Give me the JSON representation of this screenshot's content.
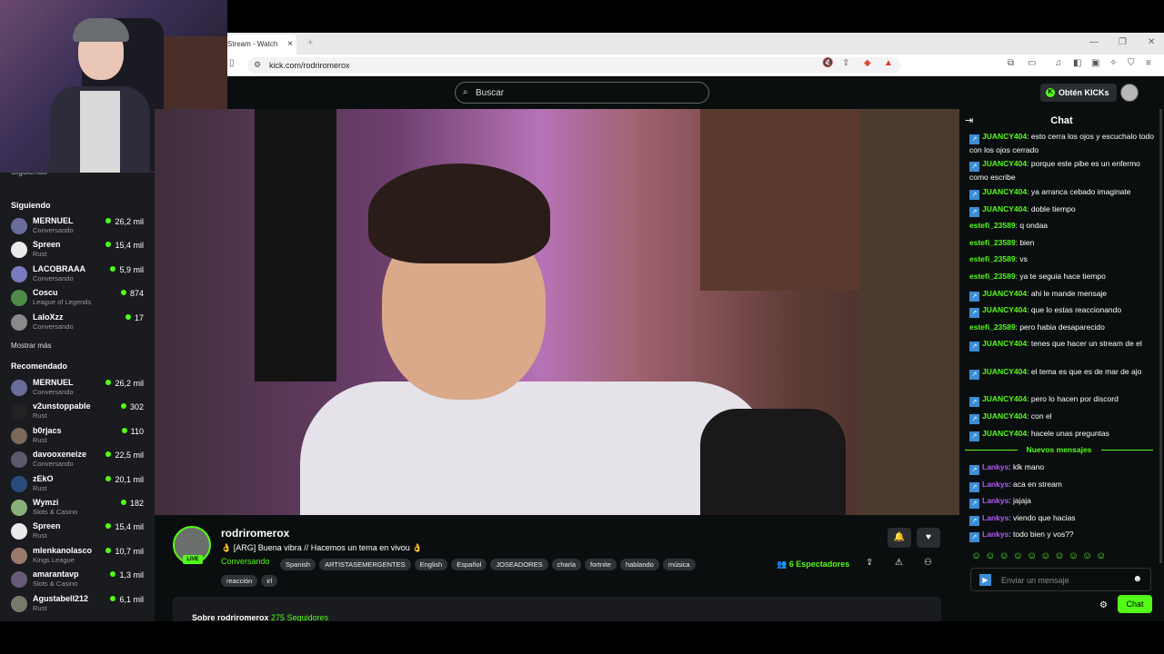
{
  "browser": {
    "tab_title": "Stream - Watch",
    "tab_close": "×",
    "new_tab": "+",
    "url": "kick.com/rodriromerox",
    "window_controls": [
      "—",
      "❐",
      "✕"
    ]
  },
  "header": {
    "search_placeholder": "Buscar",
    "kicks_button": "Obtén KICKs"
  },
  "sidebar": {
    "partial_label": "Siguiendo",
    "following_title": "Siguiendo",
    "following": [
      {
        "name": "MERNUEL",
        "category": "Conversando",
        "viewers": "26,2 mil"
      },
      {
        "name": "Spreen",
        "category": "Rust",
        "viewers": "15,4 mil"
      },
      {
        "name": "LACOBRAAA",
        "category": "Conversando",
        "viewers": "5,9 mil"
      },
      {
        "name": "Coscu",
        "category": "League of Legends",
        "viewers": "874"
      },
      {
        "name": "LaloXzz",
        "category": "Conversando",
        "viewers": "17"
      }
    ],
    "show_more": "Mostrar más",
    "recommended_title": "Recomendado",
    "recommended": [
      {
        "name": "MERNUEL",
        "category": "Conversando",
        "viewers": "26,2 mil"
      },
      {
        "name": "v2unstoppable",
        "category": "Rust",
        "viewers": "302"
      },
      {
        "name": "b0rjacs",
        "category": "Rust",
        "viewers": "110"
      },
      {
        "name": "davooxeneize",
        "category": "Conversando",
        "viewers": "22,5 mil"
      },
      {
        "name": "zEkO",
        "category": "Rust",
        "viewers": "20,1 mil"
      },
      {
        "name": "Wymzi",
        "category": "Slots & Casino",
        "viewers": "182"
      },
      {
        "name": "Spreen",
        "category": "Rust",
        "viewers": "15,4 mil"
      },
      {
        "name": "mlenkanolasco",
        "category": "Kings League",
        "viewers": "10,7 mil"
      },
      {
        "name": "amarantavp",
        "category": "Slots & Casino",
        "viewers": "1,3 mil"
      },
      {
        "name": "Agustabell212",
        "category": "Rust",
        "viewers": "6,1 mil"
      }
    ]
  },
  "stream": {
    "channel": "rodriromerox",
    "live_badge": "LIVE",
    "title": "👌 [ARG] Buena vibra // Hacemos un tema en vivou 👌",
    "category": "Conversando",
    "tags": [
      "Spanish",
      "ARTISTASEMERGENTES",
      "English",
      "Español",
      "JOSEADORES",
      "charla",
      "fortnite",
      "hablando",
      "música"
    ],
    "tags_row2": [
      "reacción",
      "irl"
    ],
    "viewers_count": "6",
    "viewers_label": "Espectadores",
    "about_prefix": "Sobre rodriromerox",
    "about_followers": "275 Seguidores"
  },
  "chat": {
    "title": "Chat",
    "messages": [
      {
        "user": "JUANCY404",
        "color": "#53fc18",
        "badge": true,
        "text": "esto cerra los ojos y escuchalo todo con los ojos cerrado"
      },
      {
        "user": "JUANCY404",
        "color": "#53fc18",
        "badge": true,
        "text": "porque este pibe es un enfermo como escribe"
      },
      {
        "user": "JUANCY404",
        "color": "#53fc18",
        "badge": true,
        "text": "ya arranca cebado imaginate"
      },
      {
        "user": "JUANCY404",
        "color": "#53fc18",
        "badge": true,
        "text": "doble tiempo"
      },
      {
        "user": "estefi_23589",
        "color": "#53fc18",
        "badge": false,
        "text": "q ondaa"
      },
      {
        "user": "estefi_23589",
        "color": "#53fc18",
        "badge": false,
        "text": "bien"
      },
      {
        "user": "estefi_23589",
        "color": "#53fc18",
        "badge": false,
        "text": "vs"
      },
      {
        "user": "estefi_23589",
        "color": "#53fc18",
        "badge": false,
        "text": "ya te seguia hace tiempo"
      },
      {
        "user": "JUANCY404",
        "color": "#53fc18",
        "badge": true,
        "text": "ahi le mande mensaje"
      },
      {
        "user": "JUANCY404",
        "color": "#53fc18",
        "badge": true,
        "text": "que lo estas reaccionando"
      },
      {
        "user": "estefi_23589",
        "color": "#53fc18",
        "badge": false,
        "text": "pero habia desaparecido"
      },
      {
        "user": "JUANCY404",
        "color": "#53fc18",
        "badge": true,
        "text": "tenes que hacer un stream de el"
      },
      {
        "user": "JUANCY404",
        "color": "#53fc18",
        "badge": true,
        "text": "el tema es que es de mar de ajo"
      },
      {
        "user": "JUANCY404",
        "color": "#53fc18",
        "badge": true,
        "text": "pero lo hacen por discord"
      },
      {
        "user": "JUANCY404",
        "color": "#53fc18",
        "badge": true,
        "text": "con el"
      },
      {
        "user": "JUANCY404",
        "color": "#53fc18",
        "badge": true,
        "text": "hacele unas preguntas"
      }
    ],
    "new_messages_label": "Nuevos mensajes",
    "new_messages": [
      {
        "user": "Lankys",
        "color": "#b05cf5",
        "badge": true,
        "text": "klk mano"
      },
      {
        "user": "Lankys",
        "color": "#b05cf5",
        "badge": true,
        "text": "aca en stream"
      },
      {
        "user": "Lankys",
        "color": "#b05cf5",
        "badge": true,
        "text": "jajaja"
      },
      {
        "user": "Lankys",
        "color": "#b05cf5",
        "badge": true,
        "text": "viendo que hacias"
      },
      {
        "user": "Lankys",
        "color": "#b05cf5",
        "badge": true,
        "text": "todo bien y vos??"
      }
    ],
    "input_placeholder": "Enviar un mensaje",
    "send_button": "Chat"
  },
  "colors": {
    "accent": "#53fc18",
    "badge_blue": "#3b8dd6"
  }
}
